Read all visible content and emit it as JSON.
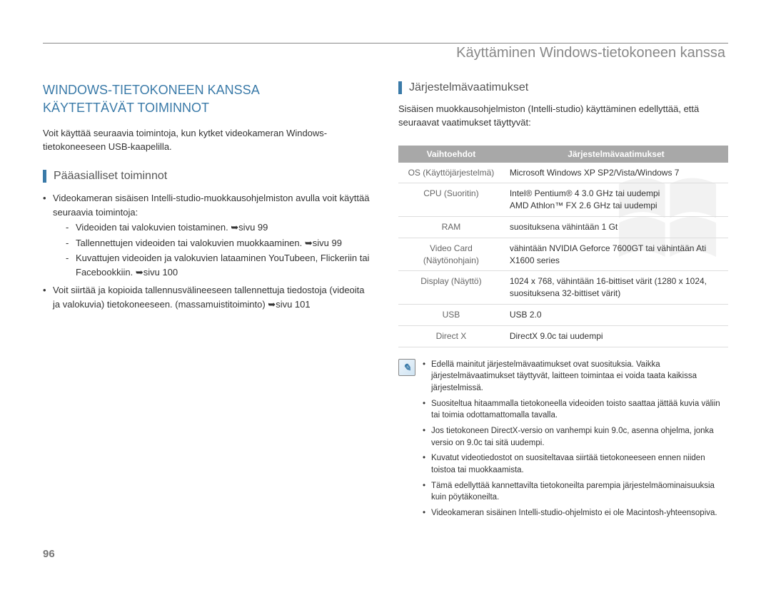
{
  "header": {
    "title": "Käyttäminen Windows-tietokoneen kanssa"
  },
  "page_number": "96",
  "left": {
    "big_title_line1": "WINDOWS-TIETOKONEEN KANSSA",
    "big_title_line2": "KÄYTETTÄVÄT TOIMINNOT",
    "intro": "Voit käyttää seuraavia toimintoja, kun kytket videokameran Windows-tietokoneeseen USB-kaapelilla.",
    "subhead": "Pääasialliset toiminnot",
    "b1": "Videokameran sisäisen Intelli-studio-muokkausohjelmiston avulla voit käyttää seuraavia toimintoja:",
    "b1a": "Videoiden tai valokuvien toistaminen. ➥sivu 99",
    "b1b": "Tallennettujen videoiden tai valokuvien muokkaaminen. ➥sivu 99",
    "b1c": "Kuvattujen videoiden ja valokuvien lataaminen YouTubeen, Flickeriin tai Facebookkiin. ➥sivu 100",
    "b2": "Voit siirtää ja kopioida tallennusvälineeseen tallennettuja tiedostoja (videoita ja valokuvia) tietokoneeseen. (massamuistitoiminto) ➥sivu 101"
  },
  "right": {
    "subhead": "Järjestelmävaatimukset",
    "intro": "Sisäisen muokkausohjelmiston (Intelli-studio) käyttäminen edellyttää, että seuraavat vaatimukset täyttyvät:",
    "table_header_left": "Vaihtoehdot",
    "table_header_right": "Järjestelmävaatimukset",
    "rows": [
      {
        "label": "OS (Käyttöjärjestelmä)",
        "value": "Microsoft Windows XP SP2/Vista/Windows 7"
      },
      {
        "label": "CPU (Suoritin)",
        "value": "Intel® Pentium® 4 3.0 GHz tai uudempi\nAMD Athlon™ FX 2.6 GHz tai uudempi"
      },
      {
        "label": "RAM",
        "value": "suosituksena vähintään 1 Gt"
      },
      {
        "label": "Video Card (Näytönohjain)",
        "value": "vähintään NVIDIA Geforce 7600GT tai vähintään Ati X1600 series"
      },
      {
        "label": "Display (Näyttö)",
        "value": "1024 x 768, vähintään 16-bittiset värit (1280 x 1024, suosituksena 32-bittiset värit)"
      },
      {
        "label": "USB",
        "value": "USB 2.0"
      },
      {
        "label": "Direct X",
        "value": "DirectX 9.0c tai uudempi"
      }
    ],
    "notes": [
      "Edellä mainitut järjestelmävaatimukset ovat suosituksia. Vaikka järjestelmävaatimukset täyttyvät, laitteen toimintaa ei voida taata kaikissa järjestelmissä.",
      "Suositeltua hitaammalla tietokoneella videoiden toisto saattaa jättää kuvia väliin tai toimia odottamattomalla tavalla.",
      "Jos tietokoneen DirectX-versio on vanhempi kuin 9.0c, asenna ohjelma, jonka versio on 9.0c tai sitä uudempi.",
      "Kuvatut videotiedostot on suositeltavaa siirtää tietokoneeseen ennen niiden toistoa tai muokkaamista.",
      "Tämä edellyttää kannettavilta tietokoneilta parempia järjestelmäominaisuuksia kuin pöytäkoneilta.",
      "Videokameran sisäinen Intelli-studio-ohjelmisto ei ole Macintosh-yhteensopiva."
    ]
  }
}
